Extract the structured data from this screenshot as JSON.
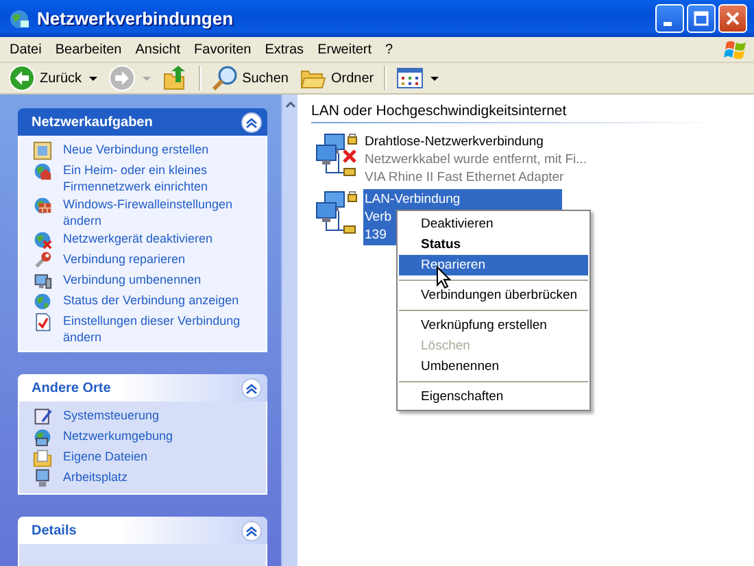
{
  "window": {
    "title": "Netzwerkverbindungen"
  },
  "menu_bar": {
    "items": [
      "Datei",
      "Bearbeiten",
      "Ansicht",
      "Favoriten",
      "Extras",
      "Erweitert",
      "?"
    ]
  },
  "toolbar": [
    {
      "kind": "back",
      "label": "Zurück",
      "disabled": false
    },
    {
      "kind": "forward",
      "disabled": true
    },
    {
      "kind": "up",
      "disabled": false
    },
    {
      "kind": "separator"
    },
    {
      "kind": "search",
      "label": "Suchen",
      "disabled": false
    },
    {
      "kind": "folders",
      "label": "Ordner",
      "disabled": false
    },
    {
      "kind": "separator"
    },
    {
      "kind": "views",
      "disabled": false
    }
  ],
  "task_pane": {
    "sections": [
      {
        "title": "Netzwerkaufgaben",
        "kind": "primary",
        "expanded": true,
        "items": [
          "Neue Verbindung erstellen",
          "Ein Heim- oder ein kleines Firmennetzwerk einrichten",
          "Windows-Firewalleinstellungen ändern",
          "Netzwerkgerät deaktivieren",
          "Verbindung reparieren",
          "Verbindung umbenennen",
          "Status der Verbindung anzeigen",
          "Einstellungen dieser Verbindung ändern"
        ]
      },
      {
        "title": "Andere Orte",
        "kind": "normal",
        "expanded": true,
        "items": [
          "Systemsteuerung",
          "Netzwerkumgebung",
          "Eigene Dateien",
          "Arbeitsplatz"
        ]
      },
      {
        "title": "Details",
        "kind": "normal",
        "expanded": true
      }
    ]
  },
  "content": {
    "group_heading": "LAN oder Hochgeschwindigkeitsinternet",
    "connections": [
      {
        "name": "Drahtlose-Netzwerkverbindung",
        "lines": [
          "Netzwerkkabel wurde entfernt, mit Fi...",
          "VIA Rhine II Fast Ethernet Adapter"
        ],
        "disconnected": true,
        "selected": false
      },
      {
        "name": "LAN-Verbindung",
        "lines": [
          "Verb",
          "139"
        ],
        "disconnected": false,
        "selected": true
      }
    ]
  },
  "context_menu": [
    {
      "kind": "item",
      "label": "Deaktivieren",
      "default": false,
      "disabled": false,
      "selected": false
    },
    {
      "kind": "item",
      "label": "Status",
      "default": true,
      "disabled": false,
      "selected": false
    },
    {
      "kind": "item",
      "label": "Reparieren",
      "default": false,
      "disabled": false,
      "selected": true
    },
    {
      "kind": "separator"
    },
    {
      "kind": "item",
      "label": "Verbindungen überbrücken",
      "default": false,
      "disabled": false,
      "selected": false
    },
    {
      "kind": "separator"
    },
    {
      "kind": "item",
      "label": "Verknüpfung erstellen",
      "default": false,
      "disabled": false,
      "selected": false
    },
    {
      "kind": "item",
      "label": "Löschen",
      "default": false,
      "disabled": true,
      "selected": false
    },
    {
      "kind": "item",
      "label": "Umbenennen",
      "default": false,
      "disabled": false,
      "selected": false
    },
    {
      "kind": "separator"
    },
    {
      "kind": "item",
      "label": "Eigenschaften",
      "default": false,
      "disabled": false,
      "selected": false
    }
  ]
}
